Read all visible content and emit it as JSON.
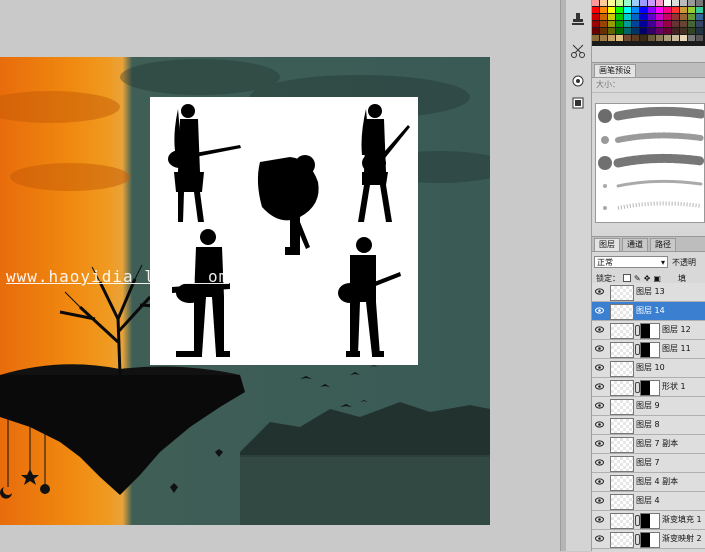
{
  "watermark": {
    "text": "www.haoyidia    lejil    om"
  },
  "tools": [
    "stamp-icon",
    "scissors-icon",
    "eraser-icon",
    "square-icon"
  ],
  "brush_panel": {
    "tabs": [
      "画笔预设"
    ],
    "sub_label": "大小：",
    "presets": [
      "round",
      "dots",
      "scatter",
      "feather",
      "spatter"
    ]
  },
  "layers_panel": {
    "tabs": [
      "图层",
      "通道",
      "路径"
    ],
    "blend_mode": "正常",
    "opacity_label": "不透明",
    "lock_label": "锁定：",
    "fill_label": "填",
    "layers": [
      {
        "name": "图层 13",
        "selected": false,
        "mask": false
      },
      {
        "name": "图层 14",
        "selected": true,
        "mask": false
      },
      {
        "name": "图层 12",
        "selected": false,
        "mask": true
      },
      {
        "name": "图层 11",
        "selected": false,
        "mask": true
      },
      {
        "name": "图层 10",
        "selected": false,
        "mask": false
      },
      {
        "name": "形状 1",
        "selected": false,
        "mask": true
      },
      {
        "name": "图层 9",
        "selected": false,
        "mask": false
      },
      {
        "name": "图层 8",
        "selected": false,
        "mask": false
      },
      {
        "name": "图层 7 副本",
        "selected": false,
        "mask": false
      },
      {
        "name": "图层 7",
        "selected": false,
        "mask": false
      },
      {
        "name": "图层 4 副本",
        "selected": false,
        "mask": false
      },
      {
        "name": "图层 4",
        "selected": false,
        "mask": false
      },
      {
        "name": "渐变填充 1",
        "selected": false,
        "mask": true
      },
      {
        "name": "渐变映射 2",
        "selected": false,
        "mask": true
      }
    ]
  },
  "colors": {
    "selection": "#3b7fd0",
    "sky_orange": "#f0880f",
    "sky_teal": "#3e5e56"
  }
}
